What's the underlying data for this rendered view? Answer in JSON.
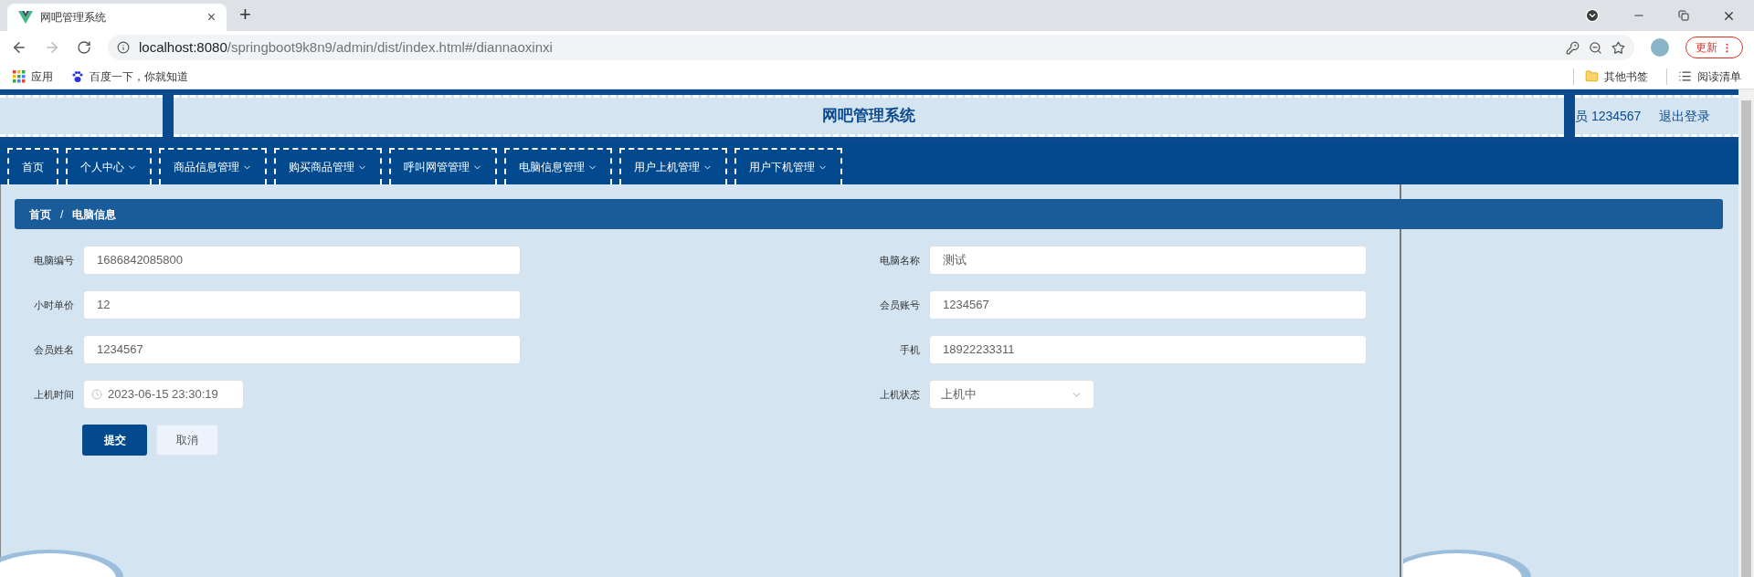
{
  "browser": {
    "tab": {
      "title": "网吧管理系统",
      "close": "×"
    },
    "new_tab": "+",
    "url_host": "localhost:8080",
    "url_path": "/springboot9k8n9/admin/dist/index.html#/diannaoxinxi",
    "update_button": "更新",
    "bookmarks": [
      {
        "label": "应用",
        "kind": "apps"
      },
      {
        "label": "百度一下，你就知道",
        "kind": "paw"
      }
    ],
    "bookmarks_right": [
      {
        "label": "其他书签",
        "kind": "folder"
      },
      {
        "label": "阅读清单",
        "kind": "list"
      }
    ]
  },
  "header": {
    "title": "网吧管理系统",
    "user": "员 1234567",
    "logout": "退出登录"
  },
  "nav": [
    {
      "label": "首页",
      "dropdown": false
    },
    {
      "label": "个人中心",
      "dropdown": true
    },
    {
      "label": "商品信息管理",
      "dropdown": true
    },
    {
      "label": "购买商品管理",
      "dropdown": true
    },
    {
      "label": "呼叫网管管理",
      "dropdown": true
    },
    {
      "label": "电脑信息管理",
      "dropdown": true
    },
    {
      "label": "用户上机管理",
      "dropdown": true
    },
    {
      "label": "用户下机管理",
      "dropdown": true
    }
  ],
  "breadcrumb": {
    "items": [
      "首页",
      "电脑信息"
    ],
    "separator": "/"
  },
  "form": {
    "rows": [
      {
        "cells": [
          {
            "label": "电脑编号",
            "value": "1686842085800",
            "kind": "text"
          },
          {
            "label": "电脑名称",
            "value": "测试",
            "kind": "text"
          }
        ]
      },
      {
        "cells": [
          {
            "label": "小时单价",
            "value": "12",
            "kind": "text"
          },
          {
            "label": "会员账号",
            "value": "1234567",
            "kind": "text"
          }
        ]
      },
      {
        "cells": [
          {
            "label": "会员姓名",
            "value": "1234567",
            "kind": "text"
          },
          {
            "label": "手机",
            "value": "18922233311",
            "kind": "text"
          }
        ]
      },
      {
        "cells": [
          {
            "label": "上机时间",
            "value": "2023-06-15 23:30:19",
            "kind": "date"
          },
          {
            "label": "上机状态",
            "value": "上机中",
            "kind": "select"
          }
        ]
      }
    ],
    "buttons": [
      {
        "label": "提交",
        "kind": "primary"
      },
      {
        "label": "取消",
        "kind": "secondary"
      }
    ]
  }
}
